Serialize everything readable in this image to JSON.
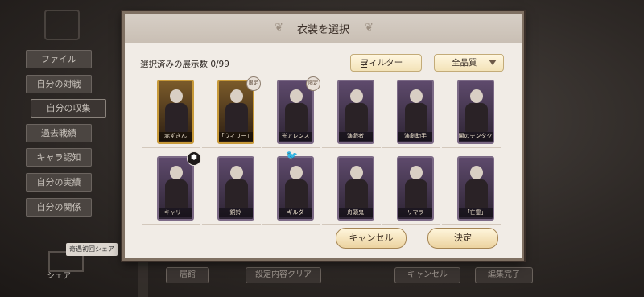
{
  "sidebar": {
    "items": [
      {
        "label": "ファイル"
      },
      {
        "label": "自分の対戦"
      },
      {
        "label": "自分の収集"
      },
      {
        "label": "過去戦績"
      },
      {
        "label": "キャラ認知"
      },
      {
        "label": "自分の実績"
      },
      {
        "label": "自分の関係"
      }
    ],
    "share_label": "奇遇初回シェア",
    "share_text": "シェア"
  },
  "background_bottom": {
    "left": "居館",
    "middle": "設定内容クリア",
    "right1": "キャンセル",
    "right2": "編集完了"
  },
  "modal": {
    "title": "衣装を選択",
    "selected_count": "選択済みの展示数 0/99",
    "filter_label": "フィルター",
    "quality_select": "全品質",
    "limited_text": "限定",
    "cancel_label": "キャンセル",
    "confirm_label": "決定"
  },
  "costumes": [
    {
      "name": "赤ずきん",
      "frame": "gold",
      "badge": ""
    },
    {
      "name": "「ウィリー」",
      "frame": "gold",
      "badge": "limited"
    },
    {
      "name": "光アレンス",
      "frame": "purple",
      "badge": "limited"
    },
    {
      "name": "演戯者",
      "frame": "purple",
      "badge": ""
    },
    {
      "name": "演劇助手",
      "frame": "purple",
      "badge": ""
    },
    {
      "name": "闇のテンタクル",
      "frame": "purple",
      "badge": ""
    },
    {
      "name": "キャリー",
      "frame": "purple",
      "badge": "skin"
    },
    {
      "name": "銅鈴",
      "frame": "purple",
      "badge": ""
    },
    {
      "name": "ギルダ",
      "frame": "purple",
      "badge": "bird"
    },
    {
      "name": "舟頭鬼",
      "frame": "purple",
      "badge": ""
    },
    {
      "name": "リマラ",
      "frame": "purple",
      "badge": ""
    },
    {
      "name": "「亡霊」",
      "frame": "purple",
      "badge": ""
    }
  ]
}
